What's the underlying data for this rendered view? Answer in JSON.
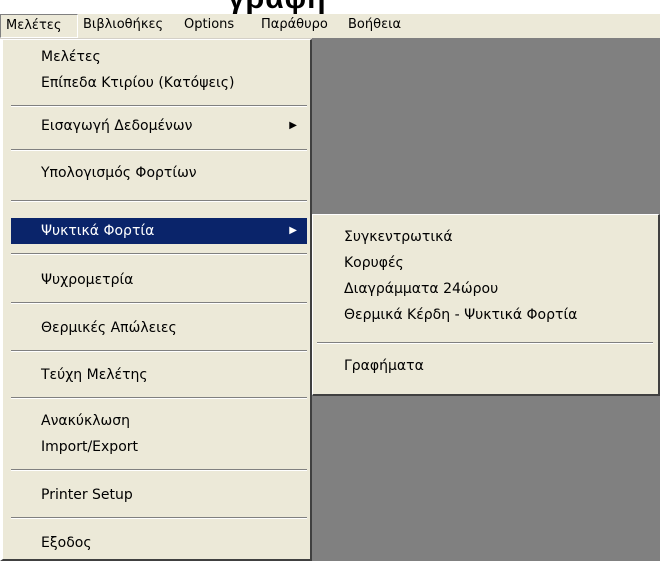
{
  "top_fragment": "γραφη",
  "menubar": {
    "items": [
      {
        "label": "Μελέτες"
      },
      {
        "label": "Βιβλιοθήκες"
      },
      {
        "label": "Options"
      },
      {
        "label": "Παράθυρο"
      },
      {
        "label": "Βοήθεια"
      }
    ]
  },
  "main_menu": {
    "items": [
      {
        "label": "Μελέτες"
      },
      {
        "label": "Επίπεδα Κτιρίου (Κατόψεις)"
      },
      {
        "label": "Εισαγωγή Δεδομένων",
        "submenu": true
      },
      {
        "label": "Υπολογισμός Φορτίων"
      },
      {
        "label": "Ψυκτικά Φορτία",
        "submenu": true,
        "highlighted": true
      },
      {
        "label": "Ψυχρομετρία"
      },
      {
        "label": "Θερμικές Απώλειες"
      },
      {
        "label": "Τεύχη Μελέτης"
      },
      {
        "label": "Ανακύκλωση"
      },
      {
        "label": "Import/Export"
      },
      {
        "label": "Printer Setup"
      },
      {
        "label": "Εξοδος"
      }
    ]
  },
  "sub_menu": {
    "items": [
      {
        "label": "Συγκεντρωτικά"
      },
      {
        "label": "Κορυφές"
      },
      {
        "label": "Διαγράμματα 24ώρου"
      },
      {
        "label": "Θερμικά Κέρδη - Ψυκτικά Φορτία"
      },
      {
        "label": "Γραφήματα"
      }
    ]
  },
  "colors": {
    "menu_bg": "#ece9d8",
    "highlight_bg": "#0a246a",
    "highlight_text": "#ffffff",
    "workspace_bg": "#808080"
  }
}
